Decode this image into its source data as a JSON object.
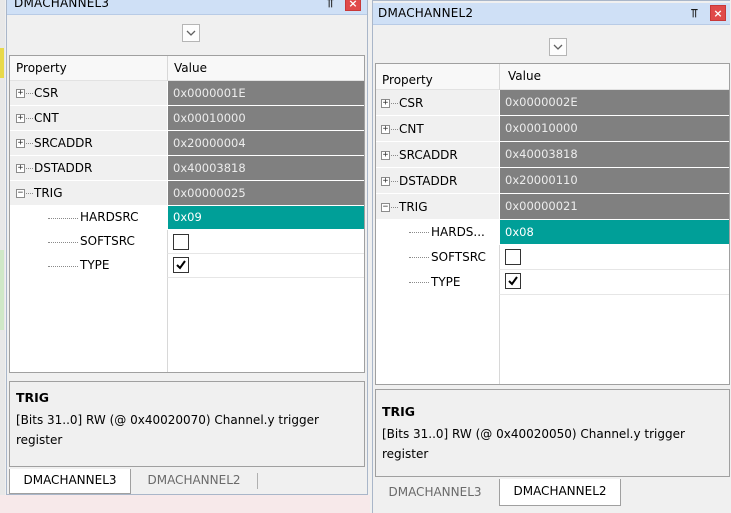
{
  "colors": {
    "title_bar": "#cfe0f6",
    "value_readonly": "#808080",
    "value_selected": "#009f98",
    "close_button": "#e04a4a"
  },
  "panels": [
    {
      "title": "DMACHANNEL3",
      "pin": "⫪",
      "close": "×",
      "header": {
        "property": "Property",
        "value": "Value"
      },
      "rows": [
        {
          "label": "CSR",
          "value": "0x0000001E"
        },
        {
          "label": "CNT",
          "value": "0x00010000"
        },
        {
          "label": "SRCADDR",
          "value": "0x20000004"
        },
        {
          "label": "DSTADDR",
          "value": "0x40003818"
        },
        {
          "label": "TRIG",
          "value": "0x00000025"
        }
      ],
      "children": [
        {
          "label": "HARDSRC",
          "value": "0x09"
        },
        {
          "label": "SOFTSRC",
          "checked": false
        },
        {
          "label": "TYPE",
          "checked": true
        }
      ],
      "description": {
        "title": "TRIG",
        "text": "[Bits 31..0] RW (@ 0x40020070) Channel.y trigger register"
      },
      "tabs": [
        "DMACHANNEL3",
        "DMACHANNEL2"
      ],
      "active_tab": 0
    },
    {
      "title": "DMACHANNEL2",
      "pin": "⫪",
      "close": "×",
      "header": {
        "property": "Property",
        "value": "Value"
      },
      "rows": [
        {
          "label": "CSR",
          "value": "0x0000002E"
        },
        {
          "label": "CNT",
          "value": "0x00010000"
        },
        {
          "label": "SRCADDR",
          "value": "0x40003818"
        },
        {
          "label": "DSTADDR",
          "value": "0x20000110"
        },
        {
          "label": "TRIG",
          "value": "0x00000021"
        }
      ],
      "children": [
        {
          "label": "HARDS...",
          "value": "0x08"
        },
        {
          "label": "SOFTSRC",
          "checked": false
        },
        {
          "label": "TYPE",
          "checked": true
        }
      ],
      "description": {
        "title": "TRIG",
        "text": "[Bits 31..0] RW (@ 0x40020050) Channel.y trigger register"
      },
      "tabs": [
        "DMACHANNEL3",
        "DMACHANNEL2"
      ],
      "active_tab": 1
    }
  ]
}
